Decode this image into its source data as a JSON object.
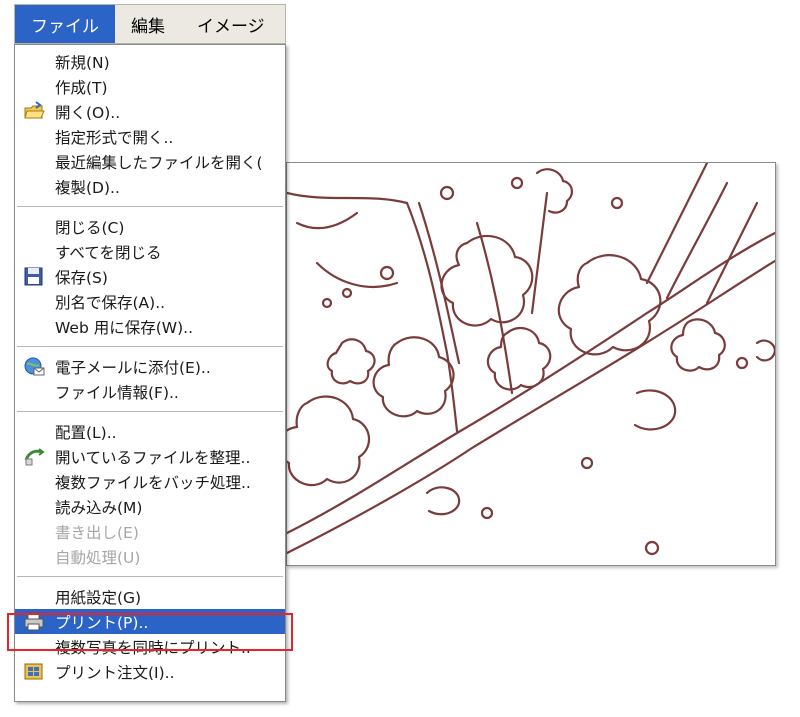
{
  "menubar": {
    "items": [
      {
        "label": "ファイル",
        "active": true
      },
      {
        "label": "編集"
      },
      {
        "label": "イメージ"
      }
    ]
  },
  "menu": {
    "group1": [
      {
        "label": "新規(N)"
      },
      {
        "label": "作成(T)"
      },
      {
        "label": "開く(O)..",
        "icon": "open-folder-icon"
      },
      {
        "label": "指定形式で開く.."
      },
      {
        "label": "最近編集したファイルを開く(",
        "has_submenu": true
      },
      {
        "label": "複製(D).."
      }
    ],
    "group2": [
      {
        "label": "閉じる(C)"
      },
      {
        "label": "すべてを閉じる"
      },
      {
        "label": "保存(S)",
        "icon": "floppy-disk-icon"
      },
      {
        "label": "別名で保存(A).."
      },
      {
        "label": "Web 用に保存(W).."
      }
    ],
    "group3": [
      {
        "label": "電子メールに添付(E)..",
        "icon": "email-attach-icon"
      },
      {
        "label": "ファイル情報(F).."
      }
    ],
    "group4": [
      {
        "label": "配置(L).."
      },
      {
        "label": "開いているファイルを整理..",
        "icon": "organize-files-icon"
      },
      {
        "label": "複数ファイルをバッチ処理.."
      },
      {
        "label": "読み込み(M)"
      },
      {
        "label": "書き出し(E)",
        "disabled": true
      },
      {
        "label": "自動処理(U)",
        "disabled": true
      }
    ],
    "group5": [
      {
        "label": "用紙設定(G)"
      },
      {
        "label": "プリント(P)..",
        "icon": "printer-icon",
        "selected": true
      },
      {
        "label": "複数写真を同時にプリント.."
      },
      {
        "label": "プリント注文(I)..",
        "icon": "print-order-icon"
      }
    ]
  },
  "colors": {
    "selection": "#2b63c6",
    "highlight_box": "#e8232a",
    "artwork_line": "#7a3b3b"
  }
}
